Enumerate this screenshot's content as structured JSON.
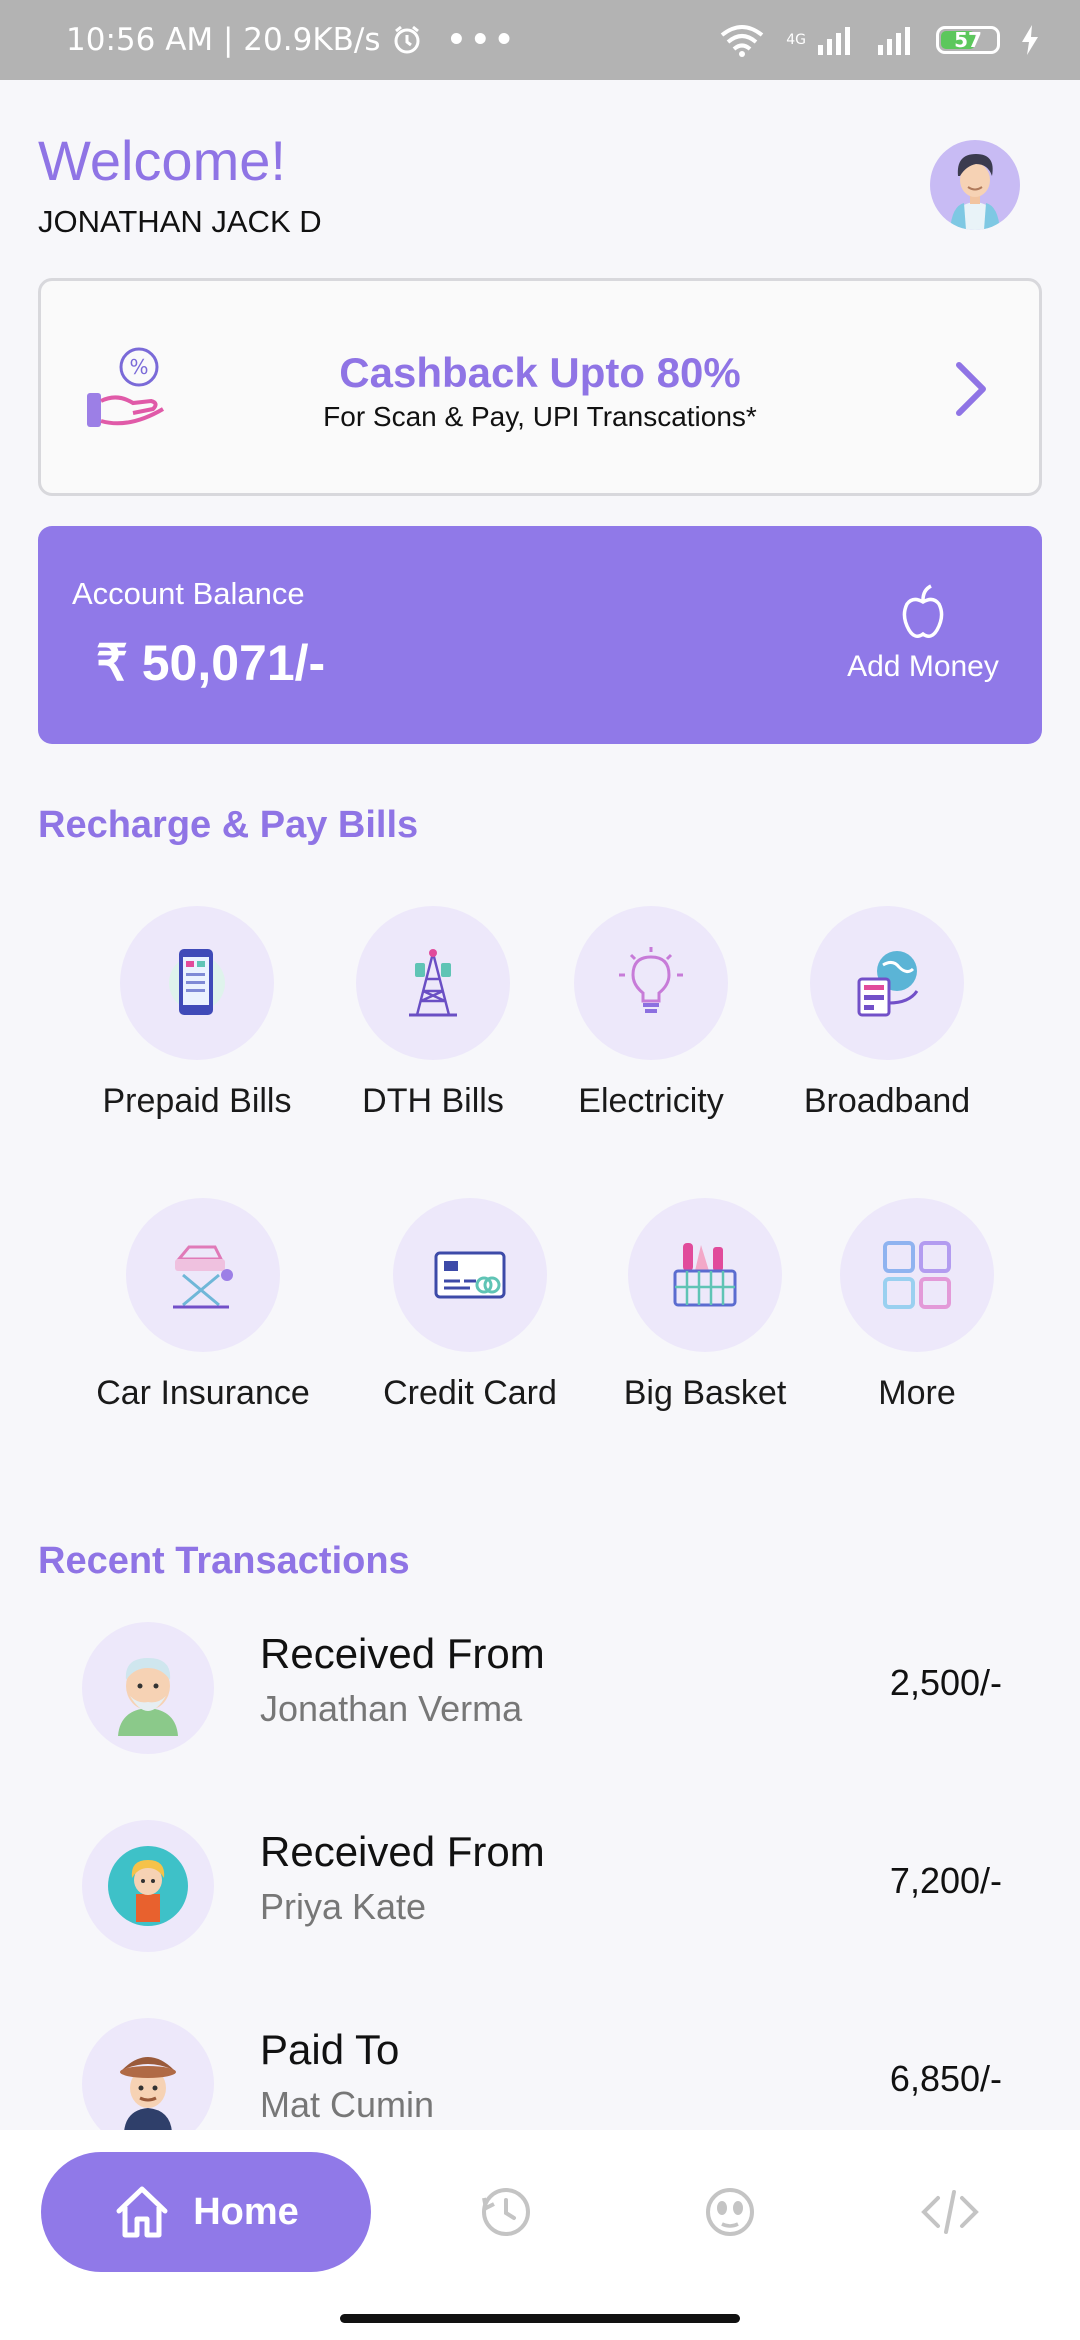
{
  "status_bar": {
    "time_speed": "10:56 AM | 20.9KB/s",
    "dots": "•••",
    "network_label": "4G",
    "battery": "57"
  },
  "header": {
    "welcome": "Welcome!",
    "username": "JONATHAN JACK D"
  },
  "cashback": {
    "title": "Cashback Upto 80%",
    "subtitle": "For Scan & Pay, UPI Transcations*"
  },
  "balance": {
    "label": "Account Balance",
    "value": "₹ 50,071/-",
    "add_money": "Add Money"
  },
  "services": {
    "title": "Recharge & Pay Bills",
    "items": [
      {
        "label": "Prepaid Bills",
        "icon": "mobile-icon"
      },
      {
        "label": "DTH Bills",
        "icon": "tower-icon"
      },
      {
        "label": "Electricity",
        "icon": "bulb-icon"
      },
      {
        "label": "Broadband",
        "icon": "globe-router-icon"
      },
      {
        "label": "Car Insurance",
        "icon": "car-lift-icon"
      },
      {
        "label": "Credit Card",
        "icon": "credit-card-icon"
      },
      {
        "label": "Big Basket",
        "icon": "basket-icon"
      },
      {
        "label": "More",
        "icon": "grid-icon"
      }
    ]
  },
  "transactions": {
    "title": "Recent Transactions",
    "items": [
      {
        "title": "Received From",
        "name": "Jonathan Verma",
        "amount": "2,500/-"
      },
      {
        "title": "Received From",
        "name": "Priya Kate",
        "amount": "7,200/-"
      },
      {
        "title": "Paid To",
        "name": "Mat Cumin",
        "amount": "6,850/-"
      }
    ]
  },
  "nav": {
    "home": "Home"
  },
  "colors": {
    "accent": "#9079e8",
    "accent_text": "#8f74e5",
    "icon_bg": "#ede8fa"
  }
}
